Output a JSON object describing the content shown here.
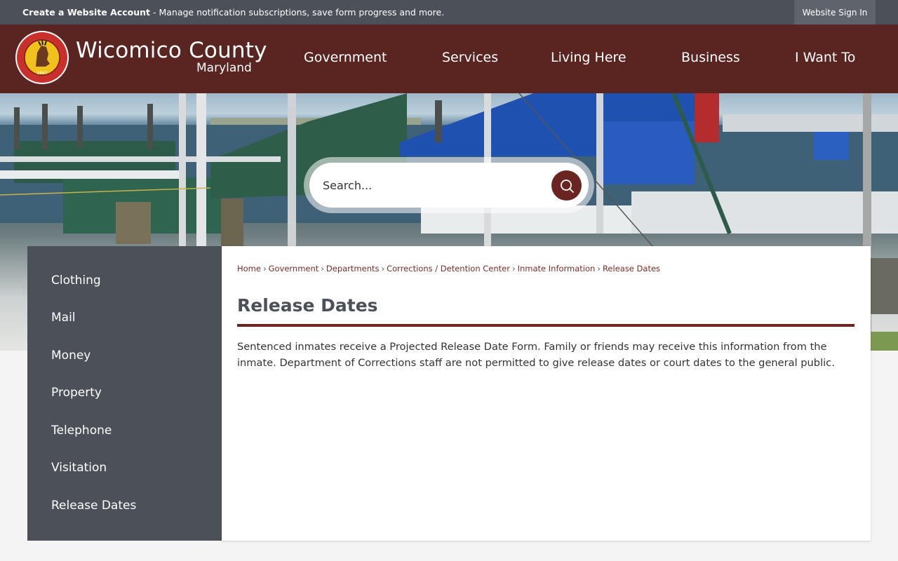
{
  "topbar": {
    "create_account": "Create a Website Account",
    "message": " - Manage notification subscriptions, save form progress and more.",
    "sign_in": "Website Sign In"
  },
  "header": {
    "title": "Wicomico County",
    "subtitle": "Maryland",
    "logo_text_top": "WICOMICO COUNTY",
    "logo_text_side": "MARYLAND",
    "logo_year": "1867"
  },
  "nav": [
    "Government",
    "Services",
    "Living Here",
    "Business",
    "I Want To"
  ],
  "search": {
    "placeholder": "Search..."
  },
  "sidebar": {
    "items": [
      "Clothing",
      "Mail",
      "Money",
      "Property",
      "Telephone",
      "Visitation",
      "Release Dates"
    ]
  },
  "breadcrumb": [
    "Home",
    "Government",
    "Departments",
    "Corrections / Detention Center",
    "Inmate Information",
    "Release Dates"
  ],
  "page": {
    "title": "Release Dates",
    "body": "Sentenced inmates receive a Projected Release Date Form. Family or friends may receive this information from the inmate. Department of Corrections staff are not permitted to give release dates or court dates to the general public."
  },
  "colors": {
    "header_bg": "#5a2420",
    "topbar_bg": "#4c5059",
    "accent": "#6b2521",
    "sidebar_bg": "#4c5059"
  },
  "icons": {
    "search": "search-icon",
    "logo": "county-seal-logo"
  }
}
